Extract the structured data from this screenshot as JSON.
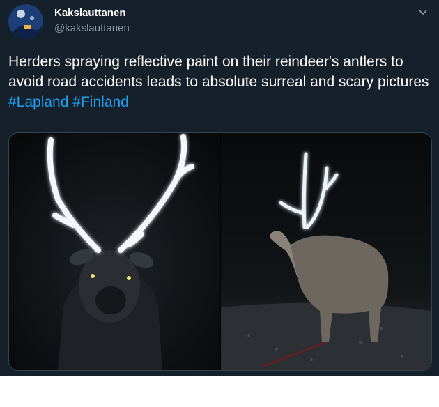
{
  "tweet": {
    "display_name": "Kakslauttanen",
    "handle": "@kakslauttanen",
    "text": "Herders spraying reflective paint on their reindeer's antlers to avoid road accidents leads to absolute surreal and scary pictures ",
    "hashtags": [
      "#Lapland",
      "#Finland"
    ],
    "menu_icon": "chevron-down-icon"
  },
  "media": {
    "photos": [
      {
        "description_icon": "reindeer-front-photo"
      },
      {
        "description_icon": "reindeer-side-photo"
      }
    ]
  },
  "colors": {
    "background": "#15202b",
    "text": "#ffffff",
    "secondary": "#8899a6",
    "link": "#1da1f2"
  }
}
